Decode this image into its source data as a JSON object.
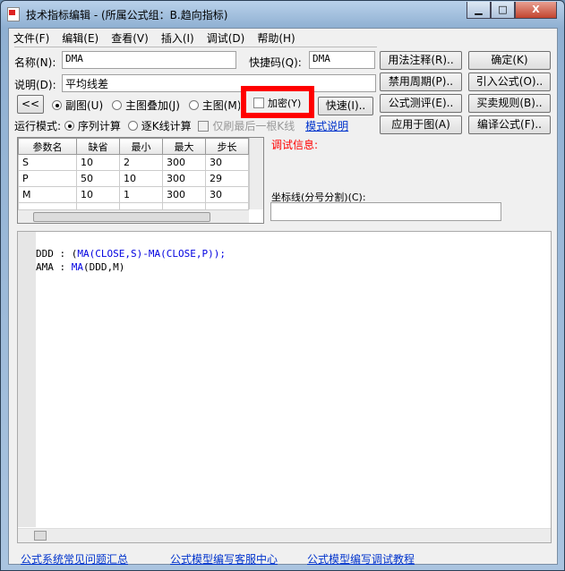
{
  "window": {
    "title": "技术指标编辑 - (所属公式组：B.趋向指标)",
    "min": "▁",
    "max": "□",
    "close": "X"
  },
  "menu": [
    "文件(F)",
    "编辑(E)",
    "查看(V)",
    "插入(I)",
    "调试(D)",
    "帮助(H)"
  ],
  "form": {
    "name_label": "名称(N):",
    "name_value": "DMA",
    "shortcut_label": "快捷码(Q):",
    "shortcut_value": "DMA",
    "desc_label": "说明(D):",
    "desc_value": "平均线差",
    "collapse": "<<",
    "radio_sub": "副图(U)",
    "radio_overlay": "主图叠加(J)",
    "radio_main": "主图(M)",
    "encrypt": "加密(Y)",
    "fast": "快速(I)..",
    "run_mode_label": "运行模式:",
    "run_seq": "序列计算",
    "run_k": "逐K线计算",
    "only_last": "仅刷最后一根K线",
    "mode_help": "模式说明"
  },
  "buttons": {
    "usage": "用法注释(R)..",
    "ok": "确定(K)",
    "disable_period": "禁用周期(P)..",
    "import": "引入公式(O)..",
    "evaluate": "公式测评(E)..",
    "trade_rules": "买卖规则(B)..",
    "apply": "应用于图(A)",
    "compile": "编译公式(F).."
  },
  "params": {
    "headers": [
      "参数名",
      "缺省",
      "最小",
      "最大",
      "步长"
    ],
    "rows": [
      [
        "S",
        "10",
        "2",
        "300",
        "30"
      ],
      [
        "P",
        "50",
        "10",
        "300",
        "29"
      ],
      [
        "M",
        "10",
        "1",
        "300",
        "30"
      ]
    ]
  },
  "debug_label": "调试信息:",
  "coord_label": "坐标线(分号分割)(C):",
  "coord_value": "",
  "code": {
    "l1a": "DDD : (",
    "ma": "MA",
    "l1b": "(CLOSE,S)-",
    "l1c": "(CLOSE,P));",
    "l2a": "AMA : ",
    "l2b": "(DDD,M)"
  },
  "links": [
    "公式系统常见问题汇总",
    "公式模型编写客服中心",
    "公式模型编写调试教程"
  ],
  "highlight_color": "#ff0000"
}
